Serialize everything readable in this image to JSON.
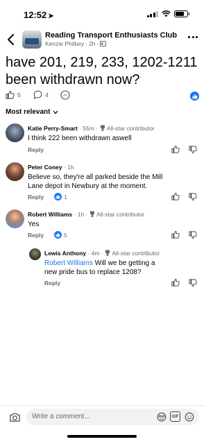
{
  "status_bar": {
    "time": "12:52"
  },
  "header": {
    "group_name": "Reading Transport Enthusiasts Club",
    "author": "Kenzie Philbey",
    "time": "2h"
  },
  "post": {
    "text": "have 201, 219, 233, 1202-1211 been withdrawn now?",
    "like_count": "6",
    "comment_count": "4"
  },
  "sort_label": "Most relevant",
  "comments": [
    {
      "name": "Katie Perry-Smart",
      "time": "55m",
      "badge": "All-star contributor",
      "text": "I think 222 been withdrawn aswell",
      "reply": "Reply",
      "likes": ""
    },
    {
      "name": "Peter Coney",
      "time": "1h",
      "badge": "",
      "text": "Believe so, they're all parked beside the Mill Lane depot in Newbury at the moment.",
      "reply": "Reply",
      "likes": "1"
    },
    {
      "name": "Robert Williams",
      "time": "1h",
      "badge": "All-star contributor",
      "text": "Yes",
      "reply": "Reply",
      "likes": "5"
    },
    {
      "name": "Lewis Anthony",
      "time": "4m",
      "badge": "All-star contributor",
      "mention": "Robert Williams",
      "text": " Will we be getting a new pride bus to replace 1208?",
      "reply": "Reply",
      "likes": ""
    }
  ],
  "composer": {
    "placeholder": "Write a comment...",
    "gif_label": "GIF"
  },
  "colors": {
    "accent": "#1877f2",
    "secondary_text": "#65676b",
    "input_bg": "#f0f2f5"
  }
}
